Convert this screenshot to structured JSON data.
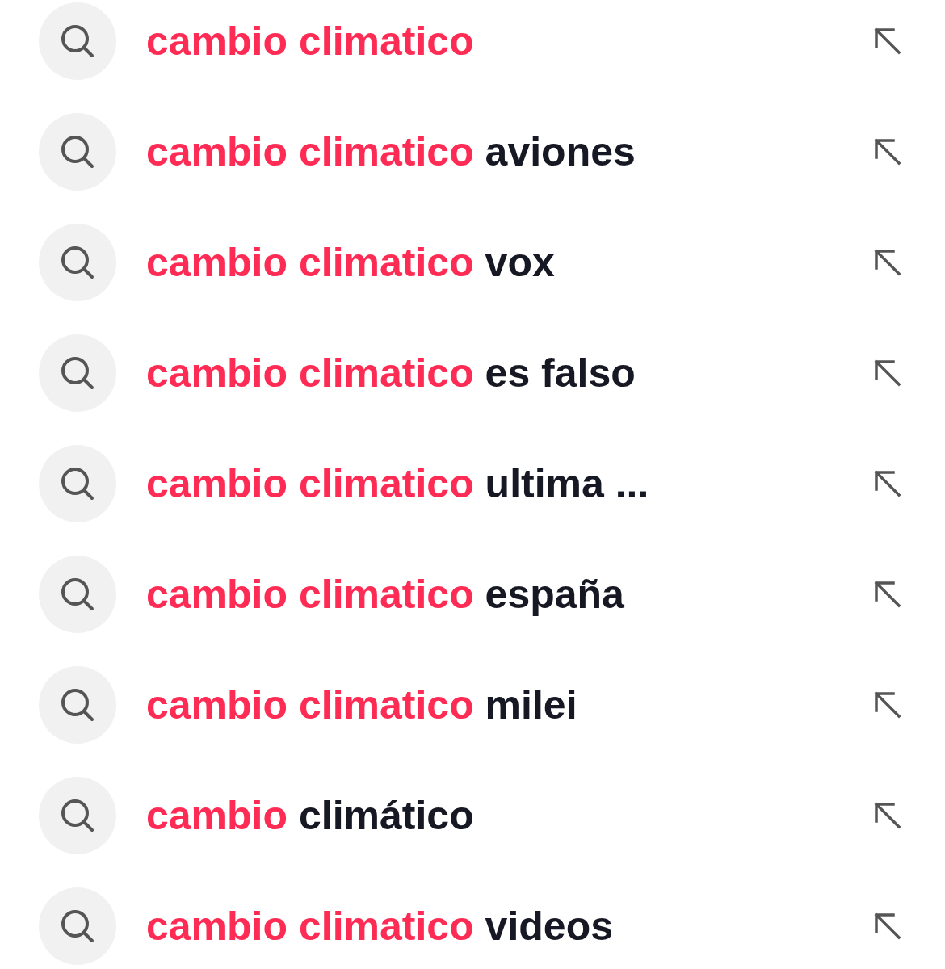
{
  "suggestions": [
    {
      "match": "cambio climatico"
    },
    {
      "match": "cambio climatico",
      "rest": "aviones"
    },
    {
      "match": "cambio climatico",
      "rest": "vox"
    },
    {
      "match": "cambio climatico",
      "rest": "es falso"
    },
    {
      "match": "cambio climatico",
      "rest": "ultima ..."
    },
    {
      "match": "cambio climatico",
      "rest": "españa"
    },
    {
      "match": "cambio climatico",
      "rest": "milei"
    },
    {
      "match": "cambio",
      "rest": "climático"
    },
    {
      "match": "cambio climatico",
      "rest": "videos"
    }
  ]
}
